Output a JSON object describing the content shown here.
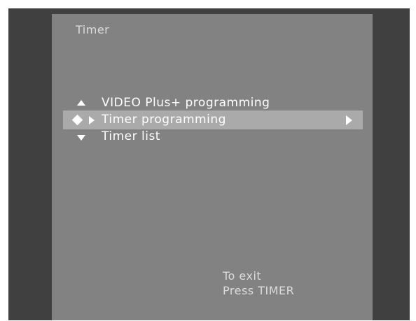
{
  "screen": {
    "title": "Timer"
  },
  "menu": {
    "items": [
      {
        "label": "VIDEO Plus+ programming",
        "icon": "up-triangle-icon"
      },
      {
        "label": "Timer programming",
        "icon": "diamond-select-icon",
        "selected": true,
        "submenu_icon": "right-triangle-icon"
      },
      {
        "label": "Timer list",
        "icon": "down-triangle-icon"
      }
    ]
  },
  "hint": {
    "line1": "To exit",
    "line2": "Press TIMER"
  },
  "colors": {
    "frame": "#404040",
    "screen_bg": "#828282",
    "highlight": "#aaaaaa",
    "text": "#ffffff"
  }
}
